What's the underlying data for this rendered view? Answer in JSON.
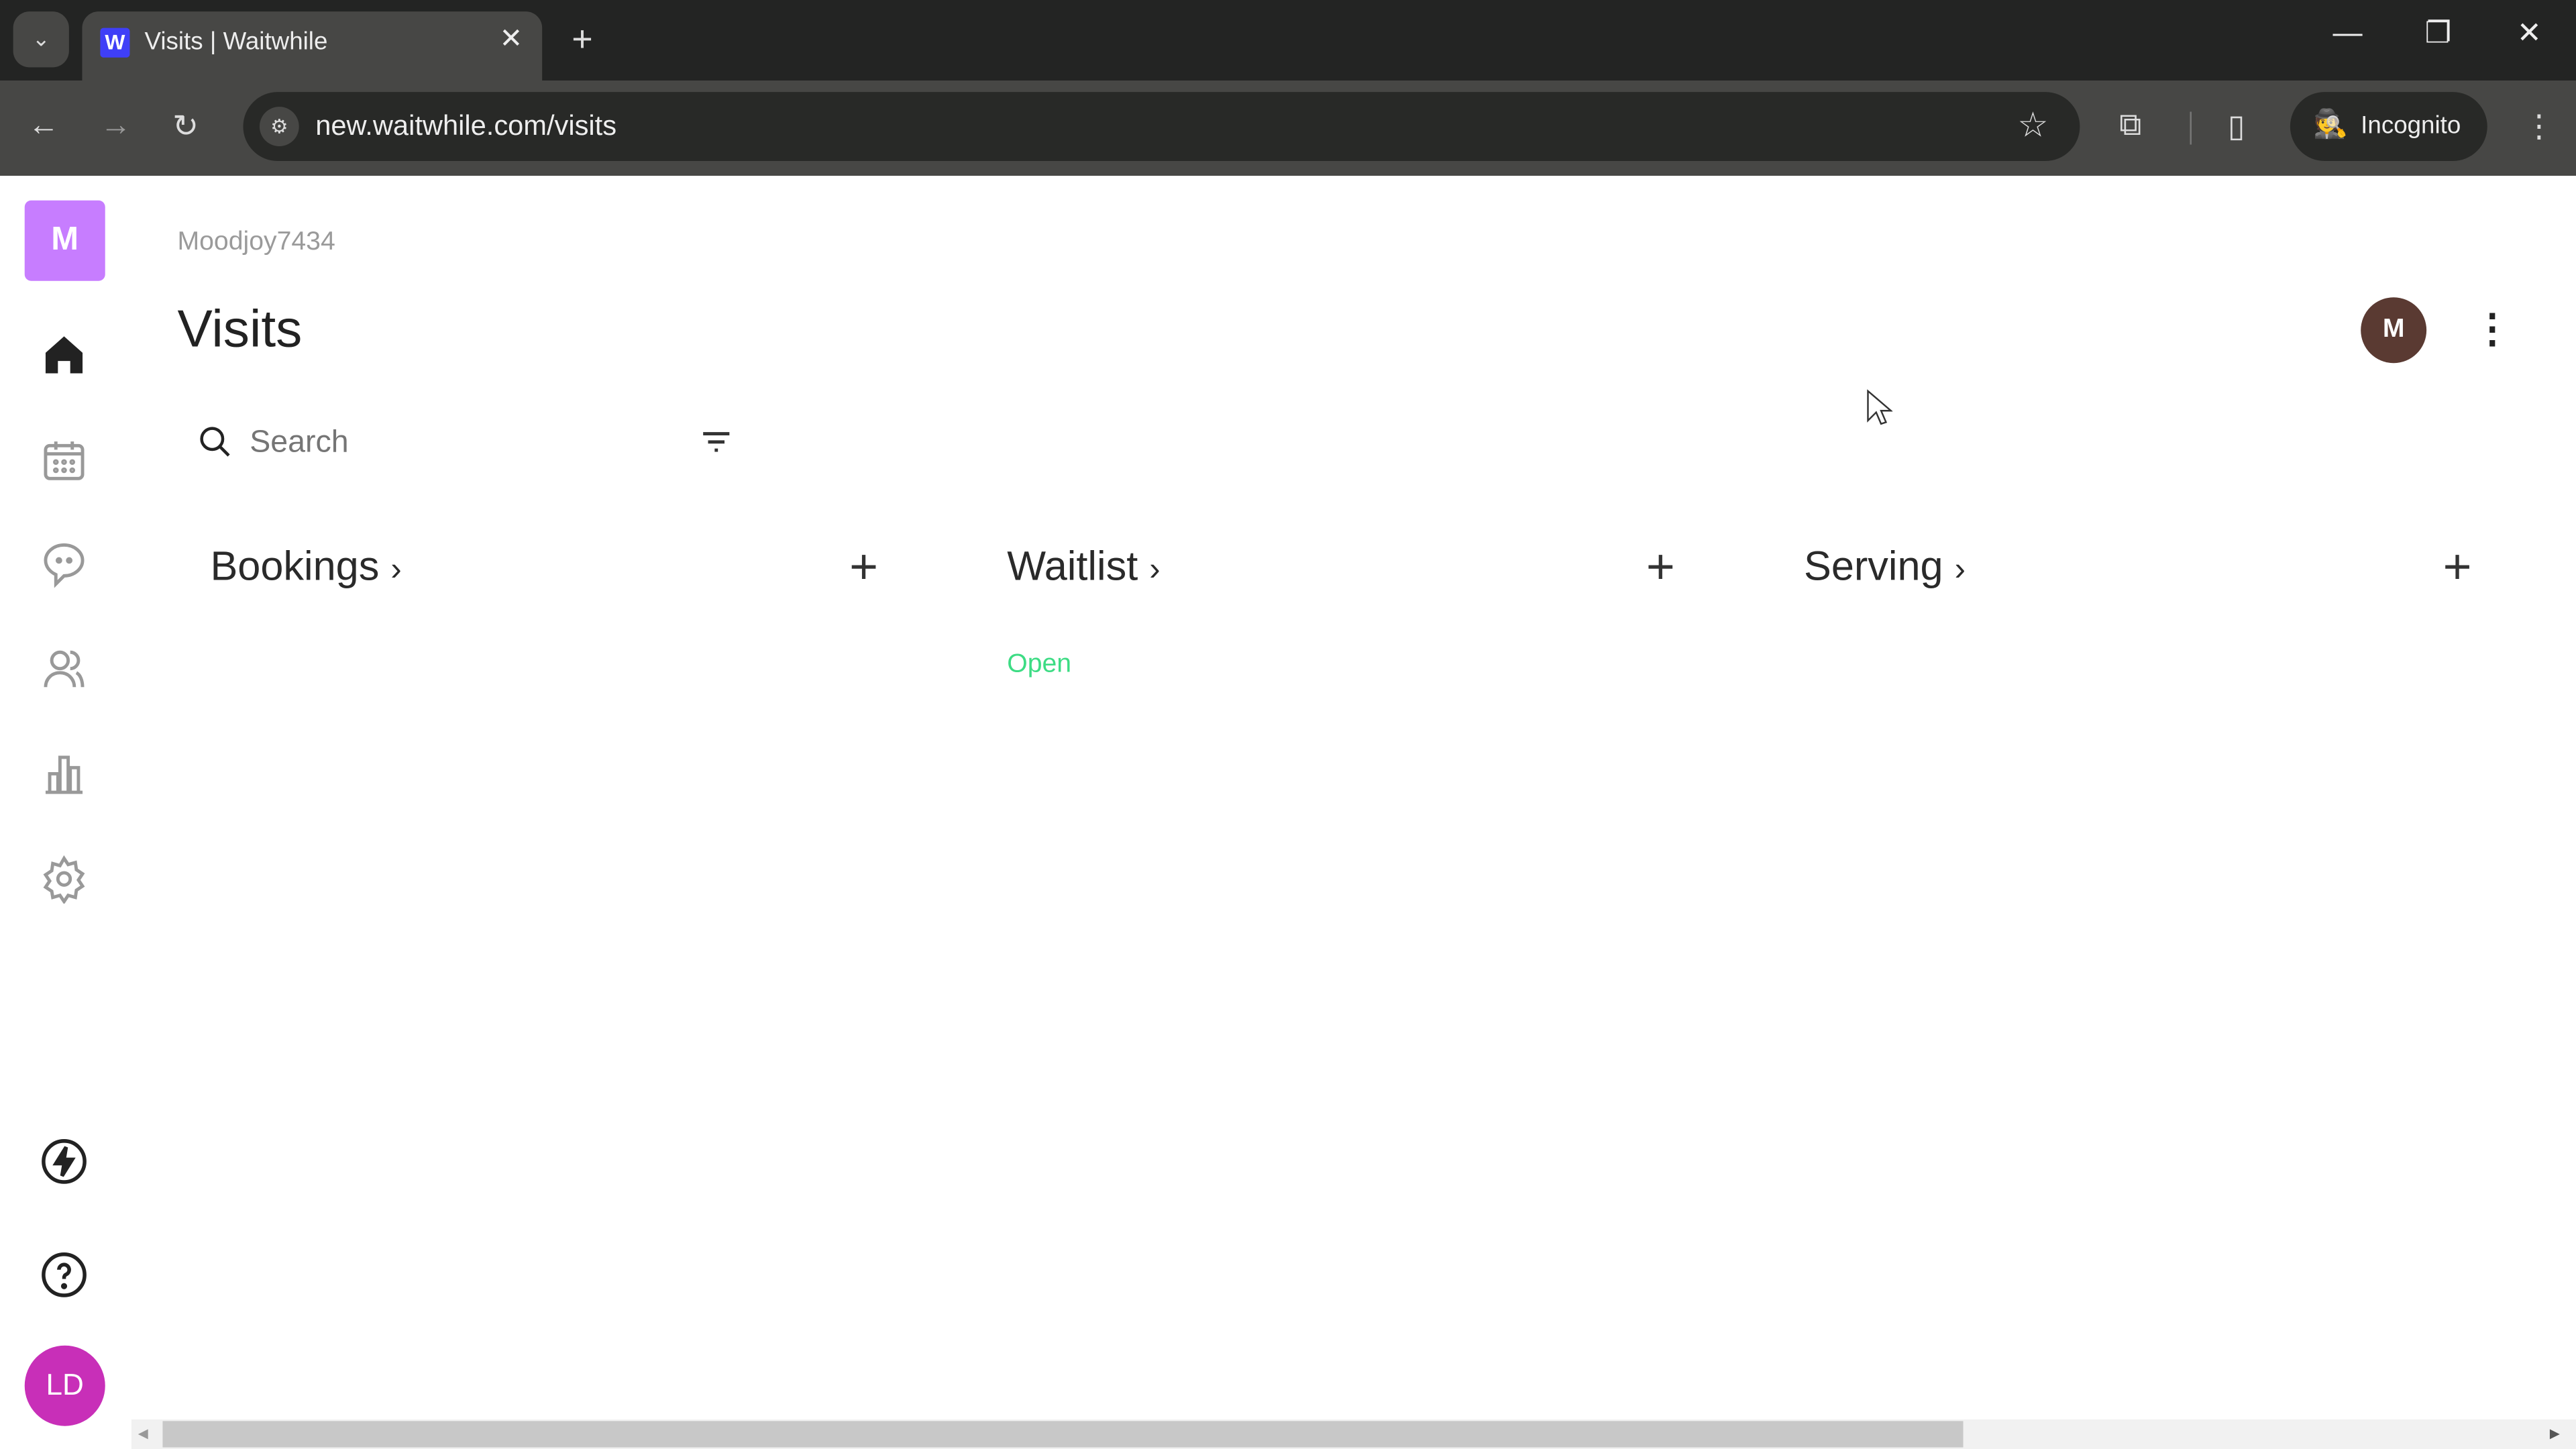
{
  "browser": {
    "tab_title": "Visits | Waitwhile",
    "favicon_letter": "W",
    "url": "new.waitwhile.com/visits",
    "incognito_label": "Incognito"
  },
  "sidebar": {
    "org_initial": "M",
    "org_color": "#c77dff",
    "items": [
      {
        "name": "home",
        "icon": "home-icon",
        "active": true
      },
      {
        "name": "calendar",
        "icon": "calendar-icon"
      },
      {
        "name": "messages",
        "icon": "chat-icon"
      },
      {
        "name": "customers",
        "icon": "users-icon"
      },
      {
        "name": "analytics",
        "icon": "bar-chart-icon"
      },
      {
        "name": "settings",
        "icon": "gear-icon"
      }
    ],
    "bottom": [
      {
        "name": "whats-new",
        "icon": "lightning-icon"
      },
      {
        "name": "help",
        "icon": "help-icon"
      }
    ],
    "user_initials": "LD",
    "user_color": "#c82fb8"
  },
  "header": {
    "location": "Moodjoy7434",
    "title": "Visits",
    "avatar_initial": "M",
    "avatar_color": "#5a3a32"
  },
  "search": {
    "placeholder": "Search"
  },
  "columns": [
    {
      "title": "Bookings",
      "status": ""
    },
    {
      "title": "Waitlist",
      "status": "Open",
      "status_color": "#3ddc84"
    },
    {
      "title": "Serving",
      "status": ""
    }
  ],
  "scrollbar": {
    "horizontal_position_percent": 0,
    "visible_fraction": 0.75
  }
}
